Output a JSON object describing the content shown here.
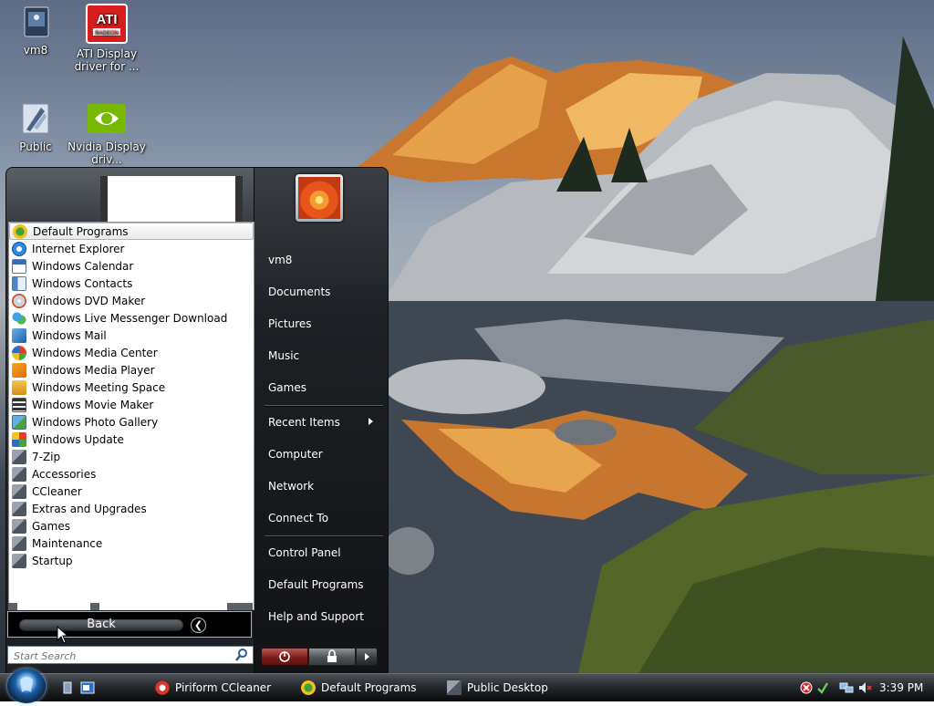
{
  "desktop": {
    "icons": [
      {
        "label": "vm8",
        "icon": "user-folder-icon"
      },
      {
        "label": "ATI Display driver for ...",
        "icon": "ati-radeon-icon"
      },
      {
        "label": "Public",
        "icon": "public-folder-icon"
      },
      {
        "label": "Nvidia Display driv...",
        "icon": "nvidia-icon"
      }
    ]
  },
  "start_menu": {
    "programs": [
      {
        "label": "Default Programs",
        "icon": "default-programs-icon",
        "selected": true
      },
      {
        "label": "Internet Explorer",
        "icon": "internet-explorer-icon"
      },
      {
        "label": "Windows Calendar",
        "icon": "calendar-icon"
      },
      {
        "label": "Windows Contacts",
        "icon": "contacts-icon"
      },
      {
        "label": "Windows DVD Maker",
        "icon": "dvd-maker-icon"
      },
      {
        "label": "Windows Live Messenger Download",
        "icon": "messenger-icon"
      },
      {
        "label": "Windows Mail",
        "icon": "mail-icon"
      },
      {
        "label": "Windows Media Center",
        "icon": "media-center-icon"
      },
      {
        "label": "Windows Media Player",
        "icon": "media-player-icon"
      },
      {
        "label": "Windows Meeting Space",
        "icon": "meeting-space-icon"
      },
      {
        "label": "Windows Movie Maker",
        "icon": "movie-maker-icon"
      },
      {
        "label": "Windows Photo Gallery",
        "icon": "photo-gallery-icon"
      },
      {
        "label": "Windows Update",
        "icon": "windows-update-icon"
      },
      {
        "label": "7-Zip",
        "icon": "folder-icon"
      },
      {
        "label": "Accessories",
        "icon": "folder-icon"
      },
      {
        "label": "CCleaner",
        "icon": "folder-icon"
      },
      {
        "label": "Extras and Upgrades",
        "icon": "folder-icon"
      },
      {
        "label": "Games",
        "icon": "folder-icon"
      },
      {
        "label": "Maintenance",
        "icon": "folder-icon"
      },
      {
        "label": "Startup",
        "icon": "folder-icon"
      }
    ],
    "back_label": "Back",
    "search_placeholder": "Start Search",
    "right_links": {
      "user": "vm8",
      "documents": "Documents",
      "pictures": "Pictures",
      "music": "Music",
      "games": "Games",
      "recent_items": "Recent Items",
      "computer": "Computer",
      "network": "Network",
      "connect_to": "Connect To",
      "control_panel": "Control Panel",
      "default_programs": "Default Programs",
      "help_and_support": "Help and Support"
    }
  },
  "taskbar": {
    "tasks": [
      {
        "label": "Piriform CCleaner",
        "icon": "ccleaner-icon"
      },
      {
        "label": "Default Programs",
        "icon": "default-programs-icon"
      },
      {
        "label": "Public Desktop",
        "icon": "folder-icon"
      }
    ],
    "clock": "3:39 PM"
  }
}
